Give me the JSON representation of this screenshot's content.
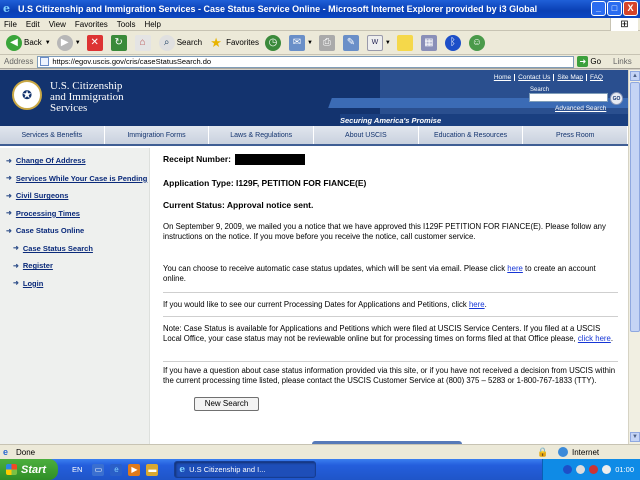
{
  "window": {
    "title": "U.S Citizenship and Immigration Services - Case Status Service Online - Microsoft Internet Explorer provided by i3 Global",
    "buttons": {
      "minimize": "_",
      "maximize": "□",
      "close": "X"
    }
  },
  "menu": [
    "File",
    "Edit",
    "View",
    "Favorites",
    "Tools",
    "Help"
  ],
  "toolbar": {
    "back": "Back",
    "search": "Search",
    "favorites": "Favorites"
  },
  "address": {
    "label": "Address",
    "url": "https://egov.uscis.gov/cris/caseStatusSearch.do",
    "go": "Go",
    "links": "Links"
  },
  "site": {
    "org_line1": "U.S. Citizenship",
    "org_line2": "and Immigration",
    "org_line3": "Services",
    "top_links": [
      "Home",
      "Contact Us",
      "Site Map",
      "FAQ"
    ],
    "search_label": "Search",
    "go": "GO",
    "advanced_search": "Advanced Search",
    "slogan": "Securing America's Promise",
    "nav": [
      "Services & Benefits",
      "Immigration Forms",
      "Laws & Regulations",
      "About USCIS",
      "Education & Resources",
      "Press Room"
    ]
  },
  "sidebar": {
    "items": [
      {
        "label": "Change Of Address"
      },
      {
        "label": "Services While Your Case is Pending"
      },
      {
        "label": "Civil Surgeons"
      },
      {
        "label": "Processing Times"
      },
      {
        "label": "Case Status Online"
      },
      {
        "label": "Case Status Search"
      },
      {
        "label": "Register"
      },
      {
        "label": "Login"
      }
    ]
  },
  "case": {
    "receipt_label": "Receipt Number:",
    "application_type": "Application Type: I129F, PETITION FOR FIANCE(E)",
    "current_status": "Current Status: Approval notice sent.",
    "status_paragraph": "On September 9, 2009, we mailed you a notice that we have approved this I129F PETITION FOR FIANCE(E). Please follow any instructions on the notice. If you move before you receive the notice, call customer service.",
    "updates_pre": "You can choose to receive automatic case status updates, which will be sent via email. Please click ",
    "updates_link": "here",
    "updates_post": " to create an account online.",
    "processing_pre": "If you would like to see our current Processing Dates for Applications and Petitions, click ",
    "processing_link": "here",
    "processing_post": ".",
    "note_text": "Note: Case Status is available for Applications and Petitions which were filed at USCIS Service Centers. If you filed at a USCIS Local Office, your case status may not be reviewable online but for processing times on forms filed at that Office please, ",
    "note_link": "click here",
    "note_post": ".",
    "question_text": "If you have a question about case status information provided via this site, or if you have not received a decision from USCIS within the current processing time listed, please contact the USCIS Customer Service at (800) 375 – 5283 or 1-800-767-1833 (TTY).",
    "new_search": "New Search"
  },
  "statusbar": {
    "status": "Done",
    "zone": "Internet"
  },
  "taskbar": {
    "start": "Start",
    "lang": "EN",
    "task": "U.S Citizenship and I...",
    "clock": "01:00"
  }
}
